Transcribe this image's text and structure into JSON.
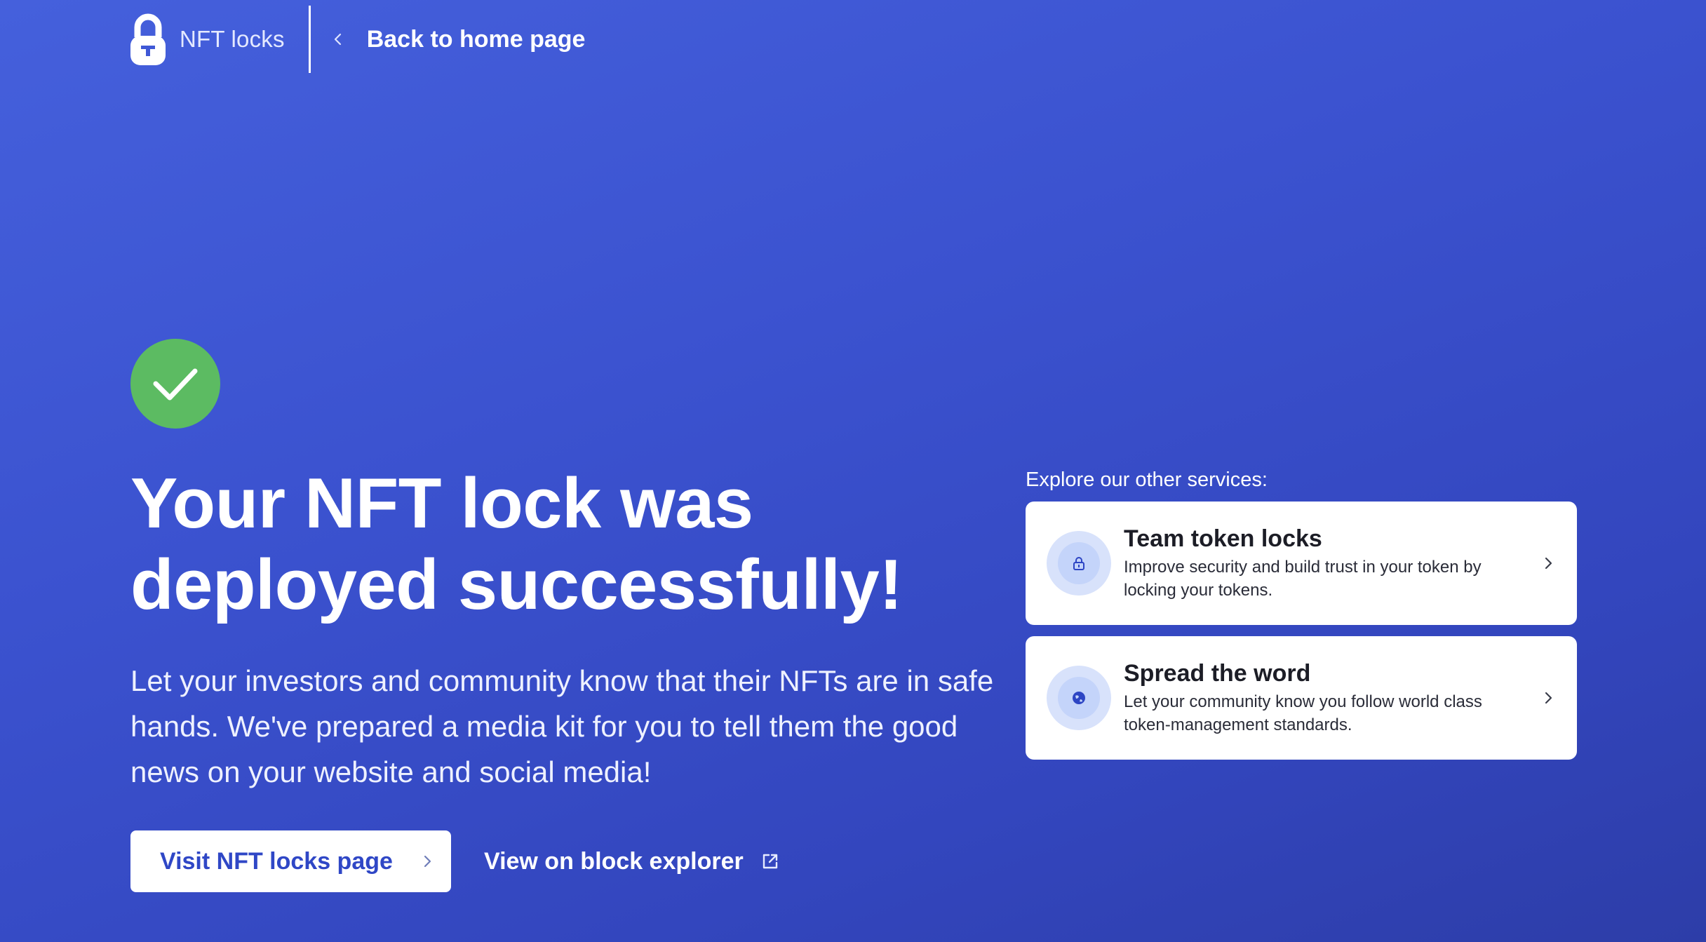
{
  "header": {
    "brand_name": "NFT locks",
    "back_label": "Back to home page"
  },
  "hero": {
    "headline": "Your NFT lock was deployed successfully!",
    "lead": "Let your investors and community know that their NFTs are in safe hands. We've prepared a media kit for you to tell them the good news on your website and social media!",
    "primary_cta": "Visit NFT locks page",
    "secondary_cta": "View on block explorer"
  },
  "services": {
    "title": "Explore our other services:",
    "items": [
      {
        "name": "Team token locks",
        "description": "Improve security and build trust in your token by locking your tokens.",
        "icon": "lock-icon"
      },
      {
        "name": "Spread the word",
        "description": "Let your community know you follow world class token-management standards.",
        "icon": "globe-icon"
      }
    ]
  },
  "colors": {
    "background": "#3b52cf",
    "success": "#5cbb62",
    "primary_text": "#2f47c6",
    "card_icon_bg": "#d8e2fb"
  }
}
